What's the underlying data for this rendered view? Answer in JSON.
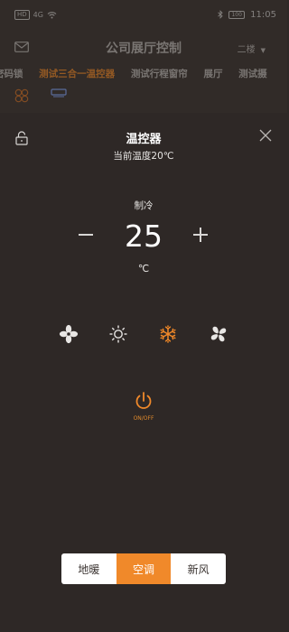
{
  "status_bar": {
    "left_badge": "HD",
    "network": "4G",
    "battery": "100",
    "time": "11:05"
  },
  "background_app": {
    "title": "公司展厅控制",
    "floor": "二楼",
    "tabs": [
      "密码锁",
      "测试三合一温控器",
      "测试行程窗帘",
      "展厅",
      "测试摄"
    ],
    "active_tab": "测试三合一温控器",
    "icons": [
      "fan-grid-icon",
      "ac-unit-icon"
    ]
  },
  "sheet": {
    "title": "温控器",
    "current_temp": "当前温度20℃",
    "mode_label": "制冷",
    "setpoint": "25",
    "unit": "℃",
    "modes": [
      {
        "name": "fan-mode-icon",
        "active": false
      },
      {
        "name": "sun-mode-icon",
        "active": false
      },
      {
        "name": "snowflake-mode-icon",
        "active": true
      },
      {
        "name": "fan-speed-icon",
        "active": false
      }
    ],
    "power_label": "ON/OFF",
    "segments": [
      "地暖",
      "空调",
      "新风"
    ],
    "active_segment": "空调"
  },
  "colors": {
    "accent": "#f0892a",
    "background": "#2e2826",
    "header_background": "#3a3330",
    "icon_inactive": "#e8e6e4"
  }
}
